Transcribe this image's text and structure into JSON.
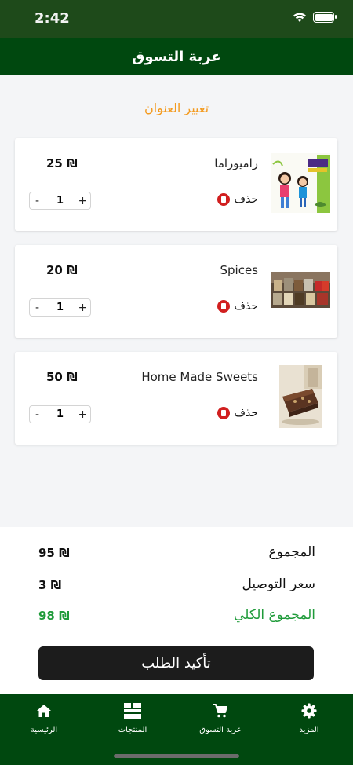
{
  "status_bar": {
    "time": "2:42"
  },
  "header": {
    "title": "عربة التسوق"
  },
  "change_address": "تغيير العنوان",
  "cart": {
    "items": [
      {
        "name": "راميوراما",
        "price": "25 ₪",
        "quantity": "1",
        "delete_label": "حذف"
      },
      {
        "name": "Spices",
        "price": "20 ₪",
        "quantity": "1",
        "delete_label": "حذف"
      },
      {
        "name": "Home Made Sweets",
        "price": "50 ₪",
        "quantity": "1",
        "delete_label": "حذف"
      }
    ],
    "stepper": {
      "minus": "-",
      "plus": "+"
    }
  },
  "summary": {
    "subtotal_label": "المجموع",
    "subtotal_value": "95 ₪",
    "delivery_label": "سعر التوصيل",
    "delivery_value": "3 ₪",
    "total_label": "المجموع الكلي",
    "total_value": "98 ₪",
    "confirm_label": "تأكيد الطلب"
  },
  "tabs": [
    {
      "label": "الرئيسية",
      "icon": "home-icon"
    },
    {
      "label": "المنتجات",
      "icon": "products-icon"
    },
    {
      "label": "عربة التسوق",
      "icon": "cart-icon"
    },
    {
      "label": "المزيد",
      "icon": "gear-icon"
    }
  ],
  "colors": {
    "primary": "#00480f",
    "accent": "#f39a1e",
    "total": "#1f9b3a",
    "delete": "#d11f1f"
  }
}
